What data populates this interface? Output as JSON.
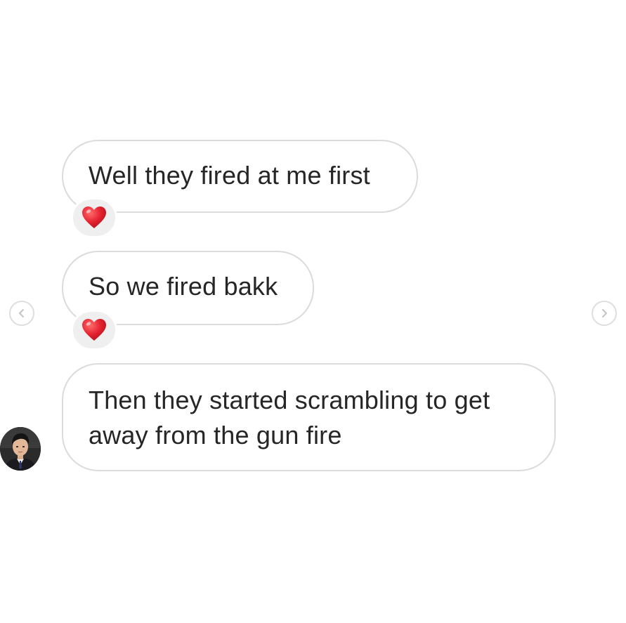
{
  "conversation": {
    "messages": [
      {
        "lines": [
          "Well they fired at me first"
        ],
        "reaction": "red-heart-icon"
      },
      {
        "lines": [
          "So we fired bakk"
        ],
        "reaction": "red-heart-icon"
      },
      {
        "lines": [
          "Then they started scrambling to get",
          "away from the gun fire"
        ],
        "reaction": null
      }
    ],
    "sender_avatar": "profile-photo"
  },
  "navigation": {
    "prev_icon": "chevron-left-icon",
    "next_icon": "chevron-right-icon"
  },
  "colors": {
    "bubble_border": "#dbdbdb",
    "text": "#262626",
    "reaction_bg": "#efefef",
    "heart": "#e0202b",
    "background": "#ffffff"
  }
}
